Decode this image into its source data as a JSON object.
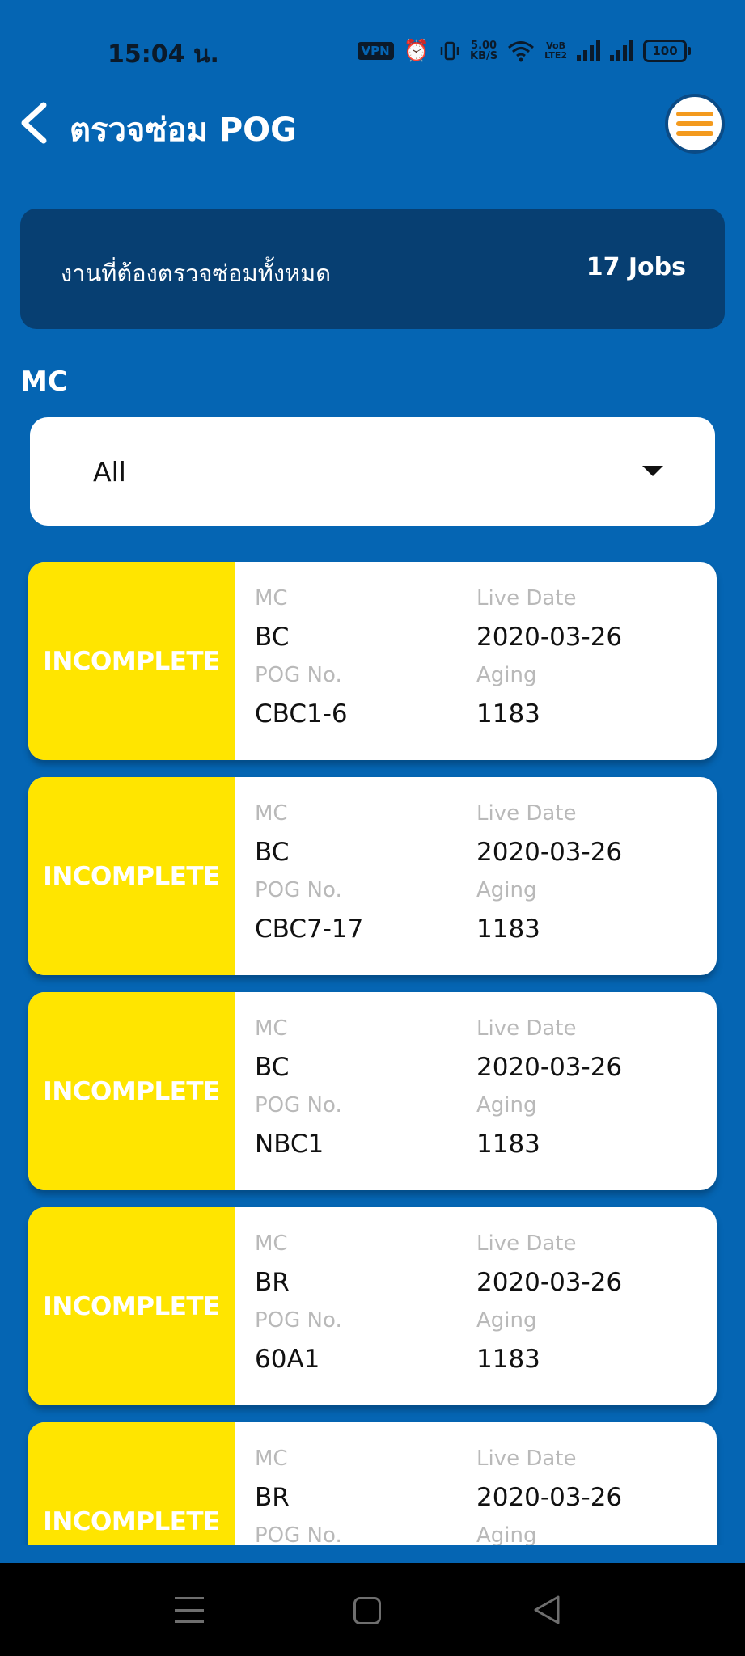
{
  "status_bar": {
    "time": "15:04 น.",
    "vpn": "VPN",
    "speed_value": "5.00",
    "speed_unit": "KB/S",
    "volte_top": "VoB",
    "volte_bottom": "LTE2",
    "battery": "100"
  },
  "header": {
    "title": "ตรวจซ่อม POG",
    "back_icon": "chevron-left-icon",
    "menu_icon": "hamburger-menu-icon"
  },
  "summary": {
    "label": "งานที่ต้องตรวจซ่อมทั้งหมด",
    "count": "17 Jobs"
  },
  "filter": {
    "label": "MC",
    "selected": "All"
  },
  "field_labels": {
    "mc": "MC",
    "live_date": "Live Date",
    "pog_no": "POG No.",
    "aging": "Aging"
  },
  "jobs": [
    {
      "status": "INCOMPLETE",
      "mc": "BC",
      "live_date": "2020-03-26",
      "pog_no": "CBC1-6",
      "aging": "1183"
    },
    {
      "status": "INCOMPLETE",
      "mc": "BC",
      "live_date": "2020-03-26",
      "pog_no": "CBC7-17",
      "aging": "1183"
    },
    {
      "status": "INCOMPLETE",
      "mc": "BC",
      "live_date": "2020-03-26",
      "pog_no": "NBC1",
      "aging": "1183"
    },
    {
      "status": "INCOMPLETE",
      "mc": "BR",
      "live_date": "2020-03-26",
      "pog_no": "60A1",
      "aging": "1183"
    },
    {
      "status": "INCOMPLETE",
      "mc": "BR",
      "live_date": "2020-03-26",
      "pog_no": "",
      "aging": ""
    }
  ],
  "colors": {
    "background": "#0565b3",
    "banner": "#073f72",
    "status_incomplete": "#ffe500",
    "menu_accent": "#f39a1e"
  }
}
